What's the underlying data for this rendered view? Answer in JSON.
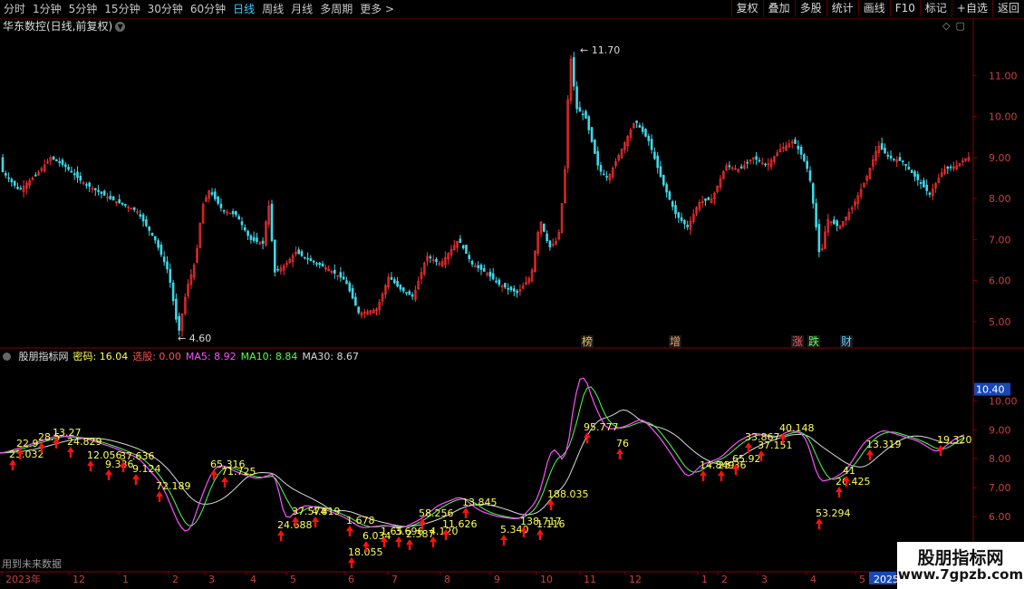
{
  "toolbar": {
    "left_items": [
      {
        "label": "分时",
        "active": false
      },
      {
        "label": "1分钟",
        "active": false
      },
      {
        "label": "5分钟",
        "active": false
      },
      {
        "label": "15分钟",
        "active": false
      },
      {
        "label": "30分钟",
        "active": false
      },
      {
        "label": "60分钟",
        "active": false
      },
      {
        "label": "日线",
        "active": true
      },
      {
        "label": "周线",
        "active": false
      },
      {
        "label": "月线",
        "active": false
      },
      {
        "label": "多周期",
        "active": false
      },
      {
        "label": "更多 >",
        "active": false
      }
    ],
    "right_buttons": [
      "复权",
      "叠加",
      "多股",
      "统计",
      "画线",
      "F10",
      "标记",
      "+自选",
      "返回"
    ]
  },
  "stock_title": "华东数控(日线,前复权)",
  "price_panel": {
    "y_ticks": [
      "11.00",
      "10.00",
      "9.00",
      "8.00",
      "7.00",
      "6.00",
      "5.00"
    ],
    "y_range": [
      4.4,
      12.0
    ],
    "high_label": "11.70",
    "low_label": "4.60",
    "event_markers": [
      {
        "text": "榜",
        "color": "#e8c060"
      },
      {
        "text": "增",
        "color": "#e8a070"
      },
      {
        "text": "涨",
        "color": "#ff5555"
      },
      {
        "text": "跌",
        "color": "#5cff5c"
      },
      {
        "text": "财",
        "color": "#5cc8ff"
      }
    ]
  },
  "indicator_panel": {
    "name": "股朋指标网",
    "params": [
      {
        "label": "密码: ",
        "value": "16.04",
        "color": "#ffff55"
      },
      {
        "label": "选股: ",
        "value": "0.00",
        "color": "#ff5050"
      },
      {
        "label": "MA5: ",
        "value": "8.92",
        "color": "#ff50ff"
      },
      {
        "label": "MA10: ",
        "value": "8.84",
        "color": "#50ff50"
      },
      {
        "label": "MA30: ",
        "value": "8.67",
        "color": "#d8d8d8"
      }
    ],
    "y_ticks": [
      "10.00",
      "9.00",
      "8.00",
      "7.00",
      "6.00"
    ],
    "current_value": "10.40",
    "y_range": [
      5.0,
      11.2
    ],
    "signal_labels": [
      "23.032",
      "22.9",
      "28.5",
      "13.27",
      "24.829",
      "12.056",
      "9.336",
      "37.636",
      "9.124",
      "72.189",
      "65.316",
      "71.725",
      "24.688",
      "37.574",
      "4.819",
      "1.678",
      "18.055",
      "6.034",
      "1.65",
      "3.696",
      "2.387",
      "58.256",
      "4.120",
      "11.626",
      "13.845",
      "5.340",
      "138.717",
      "1.116",
      "188.035",
      "95.777",
      "76",
      "14.849",
      "23.36",
      "65.92",
      "33.867",
      "37.151",
      "40.148",
      "53.294",
      "26.425",
      "41",
      "13.319",
      "19.320"
    ]
  },
  "x_axis": {
    "labels": [
      "2023年",
      "12",
      "1",
      "2",
      "3",
      "4",
      "5",
      "6",
      "7",
      "8",
      "9",
      "10",
      "11",
      "12",
      "1",
      "2",
      "3",
      "4",
      "5",
      "2025"
    ]
  },
  "footer_note": "用到未来数据",
  "watermark": {
    "title": "股朋指标网",
    "url": "www.7gpzb.com"
  },
  "colors": {
    "up": "#ff3030",
    "down": "#40d8e8",
    "axis": "#8a0000",
    "ma5": "#ff50ff",
    "ma10": "#50ff50",
    "ma30": "#d8d8d8",
    "label": "#ffff55",
    "arrow": "#ff1010"
  }
}
